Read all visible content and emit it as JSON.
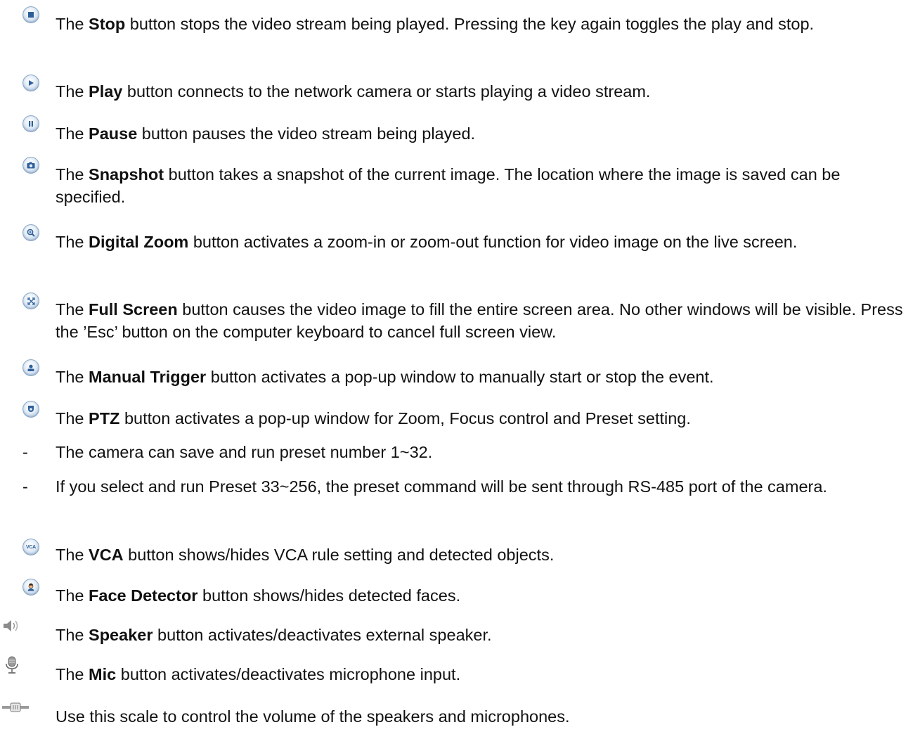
{
  "items": [
    {
      "pre": "The ",
      "name": "Stop",
      "post": " button stops the video stream being played. Pressing the key again toggles the play and stop.",
      "icon": "stop-icon"
    },
    {
      "pre": "The ",
      "name": "Play",
      "post": " button connects to the network camera or starts playing a video stream.",
      "icon": "play-icon"
    },
    {
      "pre": "The ",
      "name": "Pause",
      "post": " button pauses the video stream being played.",
      "icon": "pause-icon"
    },
    {
      "pre": "The ",
      "name": "Snapshot",
      "post": " button takes a snapshot of the current image. The location where the image is saved can be specified.",
      "icon": "snapshot-icon"
    },
    {
      "pre": "The ",
      "name": "Digital Zoom",
      "post": " button activates a zoom-in or zoom-out function for video image on the live screen.",
      "icon": "zoom-icon"
    },
    {
      "pre": "The ",
      "name": "Full Screen",
      "post": " button causes the video image to fill the entire screen area. No other windows will be visible. Press the ’Esc’ button on the computer keyboard to cancel full screen view.",
      "icon": "fullscreen-icon"
    },
    {
      "pre": "The ",
      "name": "Manual Trigger",
      "post": " button activates a pop-up window to manually start or stop the event.",
      "icon": "manual-trigger-icon"
    },
    {
      "pre": "The ",
      "name": "PTZ",
      "post": " button activates a pop-up window for Zoom, Focus control and Preset setting.",
      "icon": "ptz-icon"
    },
    {
      "pre": "The ",
      "name": "VCA",
      "post": " button shows/hides VCA rule setting and detected objects.",
      "icon": "vca-icon",
      "icon_text": "VCA"
    },
    {
      "pre": "The ",
      "name": "Face Detector",
      "post": " button shows/hides detected faces.",
      "icon": "face-detector-icon"
    },
    {
      "pre": "The ",
      "name": "Speaker",
      "post": " button activates/deactivates external speaker.",
      "icon": "speaker-icon"
    },
    {
      "pre": "The ",
      "name": "Mic",
      "post": " button activates/deactivates microphone input.",
      "icon": "mic-icon"
    },
    {
      "pre": "",
      "name": "",
      "post": "Use this scale to control the volume of the speakers and microphones.",
      "icon": "volume-scale-icon"
    }
  ],
  "ptz_notes": [
    {
      "bullet": "-",
      "text": "The camera can save and run preset number 1~32."
    },
    {
      "bullet": "-",
      "text": "If you select and run Preset 33~256, the preset command will be sent through RS-485 port of the camera."
    }
  ],
  "colors": {
    "icon_border": "#8aa7c6",
    "icon_glyph": "#2f5f9a",
    "text": "#111111"
  }
}
